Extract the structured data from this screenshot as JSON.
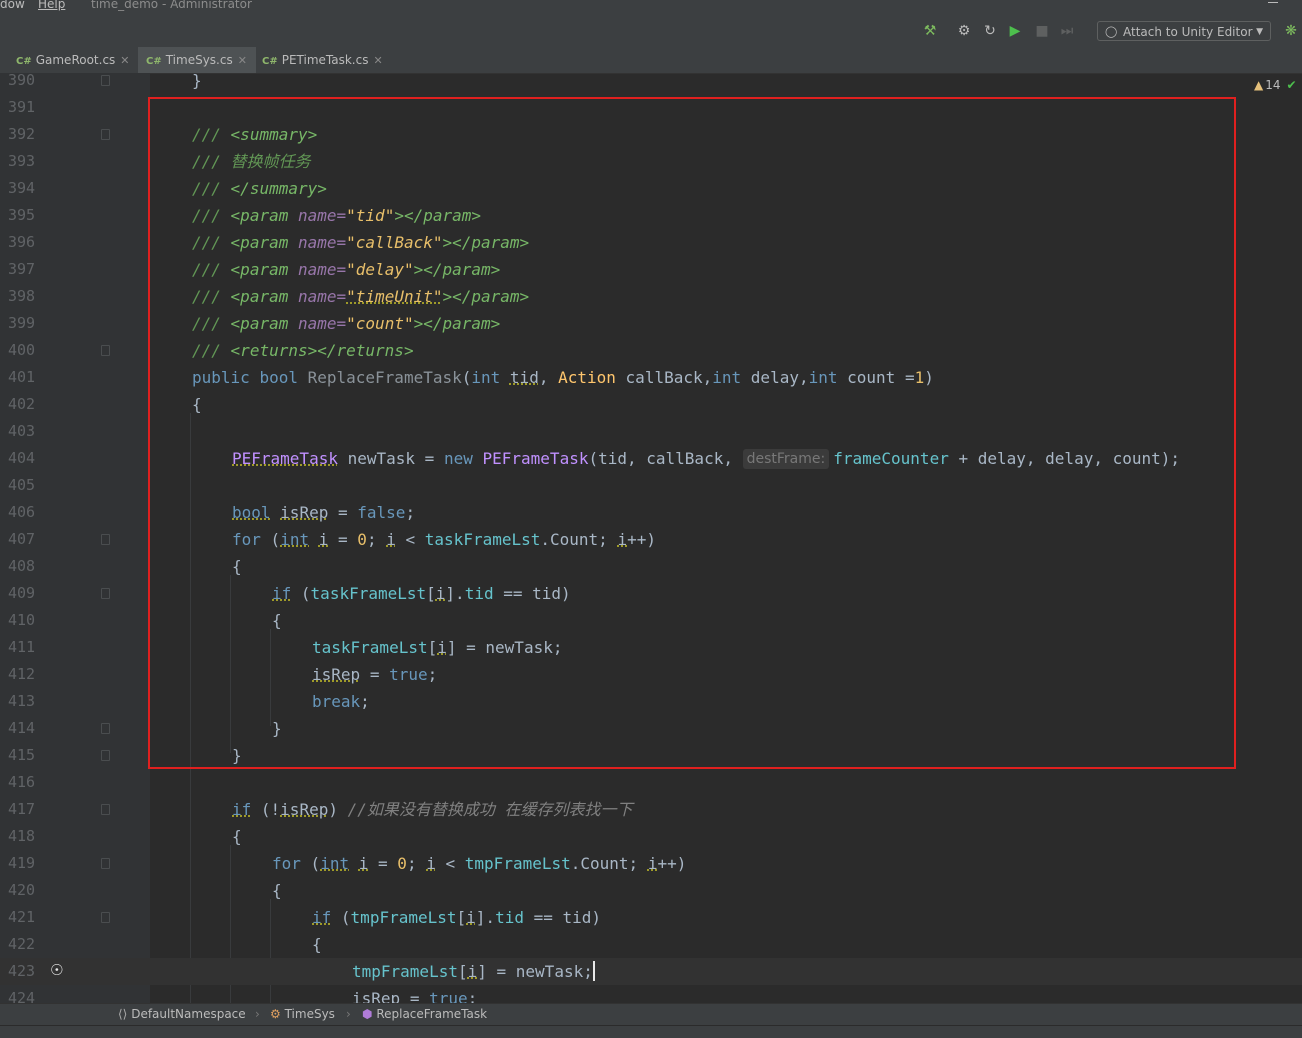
{
  "window": {
    "menu_left": "dow",
    "menu_help": "Help",
    "title": "time_demo - Administrator"
  },
  "toolbar": {
    "attach_label": "Attach to Unity Editor",
    "icons": [
      "hammer-icon",
      "debug-attach-icon",
      "refresh-icon",
      "run-icon",
      "stop-icon",
      "step-icon",
      "bug-icon"
    ]
  },
  "tabs": [
    {
      "lang": "C#",
      "label": "GameRoot.cs"
    },
    {
      "lang": "C#",
      "label": "TimeSys.cs"
    },
    {
      "lang": "C#",
      "label": "PETimeTask.cs"
    }
  ],
  "inspection": {
    "warnings": "14"
  },
  "line_numbers": [
    "390",
    "391",
    "392",
    "393",
    "394",
    "395",
    "396",
    "397",
    "398",
    "399",
    "400",
    "401",
    "402",
    "403",
    "404",
    "405",
    "406",
    "407",
    "408",
    "409",
    "410",
    "411",
    "412",
    "413",
    "414",
    "415",
    "416",
    "417",
    "418",
    "419",
    "420",
    "421",
    "422",
    "423",
    "424"
  ],
  "code": {
    "l390": "}",
    "doc_prefix": "///",
    "summary_open": "<summary>",
    "summary_text": "替换帧任务",
    "summary_close": "</summary>",
    "param_open": "<param",
    "param_name_attr": "name=",
    "param_close": "></param>",
    "param_names": [
      "\"tid\"",
      "\"callBack\"",
      "\"delay\"",
      "\"timeUnit\"",
      "\"count\""
    ],
    "returns": "<returns></returns>",
    "l401": {
      "public": "public",
      "bool": "bool",
      "method": "ReplaceFrameTask",
      "open": "(",
      "int": "int",
      "tid": "tid",
      "comma1": ",",
      "action": "Action",
      "callback": "callBack,",
      "int2": "int",
      "delay": "delay,",
      "int3": "int",
      "count": "count =",
      "one": "1",
      "close": ")"
    },
    "brace_open": "{",
    "brace_close": "}",
    "l404": {
      "type": "PEFrameTask",
      "var": "newTask =",
      "new": "new",
      "type2": "PEFrameTask",
      "args": "(tid, callBack,",
      "hint": "destFrame:",
      "field": "frameCounter",
      "rest": "+ delay, delay, count);"
    },
    "l406": {
      "bool": "bool",
      "var": "isRep",
      "eq": "=",
      "false": "false",
      "semi": ";"
    },
    "l407": {
      "for": "for",
      "open": "(",
      "int": "int",
      "i": "i",
      "eq": "=",
      "zero": "0",
      "semi1": ";",
      "i2": "i",
      "lt": "<",
      "field": "taskFrameLst",
      "dot": ".Count;",
      "i3": "i",
      "inc": "++)"
    },
    "l409": {
      "if": "if",
      "open": "(",
      "field": "taskFrameLst",
      "idx_open": "[",
      "i": "i",
      "idx_close": "].",
      "tid": "tid",
      "rest": "== tid)"
    },
    "l411": {
      "field": "taskFrameLst",
      "idx_open": "[",
      "i": "i",
      "rest": "] = newTask;"
    },
    "l412": {
      "var": "isRep",
      "eq": "=",
      "true": "true",
      "semi": ";"
    },
    "l413": {
      "break": "break",
      "semi": ";"
    },
    "l417": {
      "if": "if",
      "open": "(!",
      "var": "isRep",
      "close": ")",
      "comment": "//如果没有替换成功 在缓存列表找一下"
    },
    "l419": {
      "for": "for",
      "open": "(",
      "int": "int",
      "i": "i",
      "eq": "=",
      "zero": "0",
      "semi1": ";",
      "i2": "i",
      "lt": "<",
      "field": "tmpFrameLst",
      "dot": ".Count;",
      "i3": "i",
      "inc": "++)"
    },
    "l421": {
      "if": "if",
      "open": "(",
      "field": "tmpFrameLst",
      "idx_open": "[",
      "i": "i",
      "idx_close": "].",
      "tid": "tid",
      "rest": "== tid)"
    },
    "l423": {
      "field": "tmpFrameLst",
      "idx_open": "[",
      "i": "i",
      "rest": "] = newTask;"
    },
    "l424": {
      "var": "isRep",
      "eq": "=",
      "true": "true",
      "semi": ";"
    }
  },
  "breadcrumb": [
    {
      "icon": "namespace-icon",
      "label": "DefaultNamespace"
    },
    {
      "icon": "class-icon",
      "label": "TimeSys"
    },
    {
      "icon": "method-icon",
      "label": "ReplaceFrameTask"
    }
  ]
}
